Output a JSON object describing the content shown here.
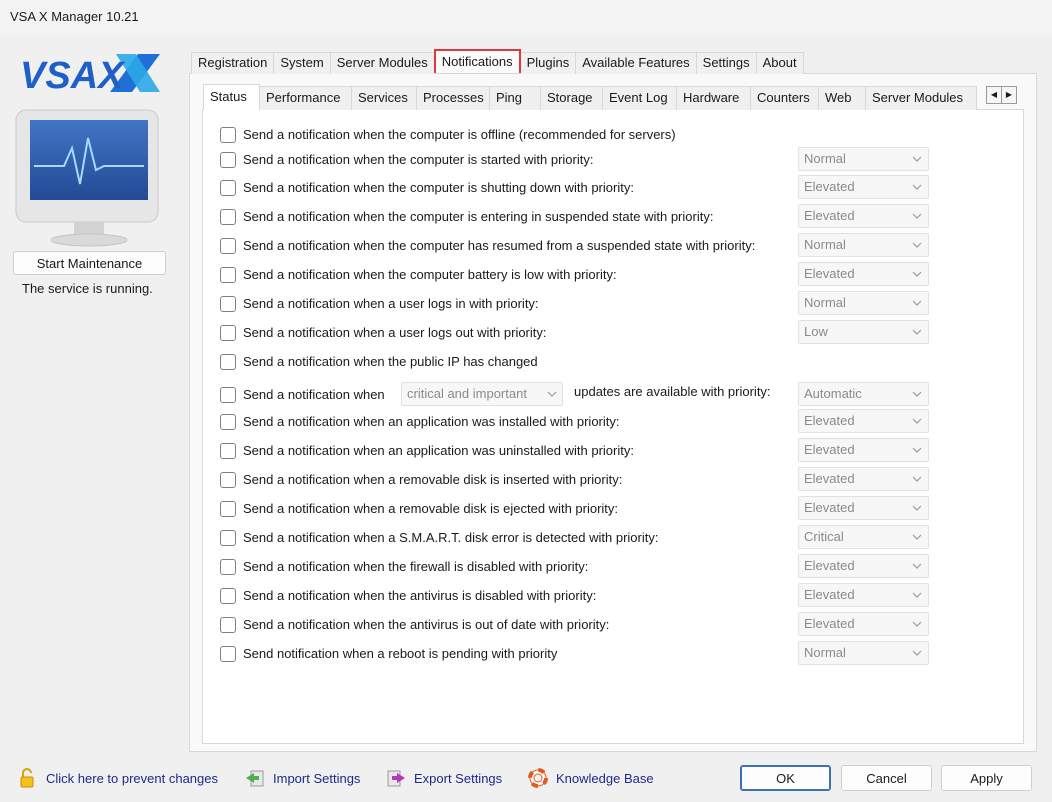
{
  "window": {
    "title": "VSA X Manager 10.21"
  },
  "left": {
    "logo_text": "VSAX",
    "start_button": "Start Maintenance",
    "status_text": "The service is running."
  },
  "main_tabs": [
    "Registration",
    "System",
    "Server Modules",
    "Notifications",
    "Plugins",
    "Available Features",
    "Settings",
    "About"
  ],
  "active_main_tab": "Notifications",
  "sub_tabs": [
    "Status",
    "Performance",
    "Services",
    "Processes",
    "Ping",
    "Storage",
    "Event Log",
    "Hardware",
    "Counters",
    "Web",
    "Server Modules"
  ],
  "active_sub_tab": "Status",
  "notifications": [
    {
      "label": "Send a notification when the computer is offline (recommended for servers)",
      "priority": null
    },
    {
      "label": "Send a notification when the computer is started with priority:",
      "priority": "Normal"
    },
    {
      "label": "Send a notification when the computer is shutting down with priority:",
      "priority": "Elevated"
    },
    {
      "label": "Send a notification when the computer is entering in suspended state with priority:",
      "priority": "Elevated"
    },
    {
      "label": "Send a notification when the computer has resumed from a suspended state with priority:",
      "priority": "Normal"
    },
    {
      "label": "Send a notification when the computer battery is low with priority:",
      "priority": "Elevated"
    },
    {
      "label": "Send a notification when a user logs in with priority:",
      "priority": "Normal"
    },
    {
      "label": "Send a notification when a user logs out with priority:",
      "priority": "Low"
    },
    {
      "label": "Send a notification when the public IP has changed",
      "priority": null
    },
    {
      "label": "Send a notification when",
      "priority": "Automatic"
    },
    {
      "label": "Send a notification when an application was installed with priority:",
      "priority": "Elevated"
    },
    {
      "label": "Send a notification when an application was uninstalled with priority:",
      "priority": "Elevated"
    },
    {
      "label": "Send a notification when a removable disk is inserted with priority:",
      "priority": "Elevated"
    },
    {
      "label": "Send a notification when a removable disk is ejected with priority:",
      "priority": "Elevated"
    },
    {
      "label": "Send a notification when a S.M.A.R.T. disk error is detected with priority:",
      "priority": "Critical"
    },
    {
      "label": "Send a notification when the firewall is disabled with priority:",
      "priority": "Elevated"
    },
    {
      "label": "Send a notification when the antivirus is disabled with priority:",
      "priority": "Elevated"
    },
    {
      "label": "Send a notification when the antivirus is out of date with priority:",
      "priority": "Elevated"
    },
    {
      "label": "Send notification when a reboot is pending with priority",
      "priority": "Normal"
    }
  ],
  "updates_row": {
    "severity": "critical and important",
    "suffix": "updates are available with priority:"
  },
  "footer": {
    "prevent_changes": "Click here to prevent changes",
    "import_settings": "Import Settings",
    "export_settings": "Export Settings",
    "knowledge_base": "Knowledge Base",
    "ok": "OK",
    "cancel": "Cancel",
    "apply": "Apply"
  },
  "colors": {
    "accent_highlight": "#e0383e",
    "link": "#1b2a8a",
    "logo_blue": "#1f6fd6"
  }
}
